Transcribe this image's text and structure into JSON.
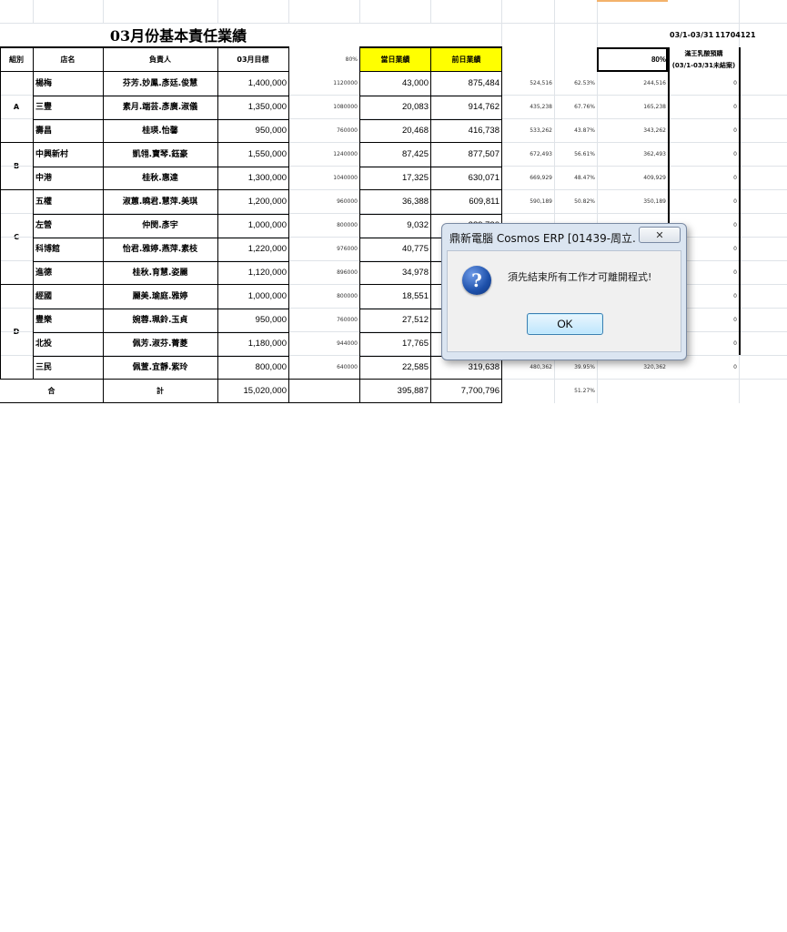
{
  "sheet": {
    "title": "03月份基本責任業績",
    "date_range": "03/1-03/31",
    "code": "11704121",
    "headers": {
      "group": "組別",
      "store": "店名",
      "manager": "負責人",
      "target": "03月目標",
      "pct80": "80%",
      "today": "當日業績",
      "prior": "前日業績",
      "pct80b": "80%",
      "bonus_line1": "滿王乳酸預購",
      "bonus_line2": "(03/1-03/31未結案)"
    },
    "groups": [
      {
        "name": "A"
      },
      {
        "name": "B"
      },
      {
        "name": "C"
      },
      {
        "name": "D"
      }
    ],
    "rows": [
      {
        "store": "楊梅",
        "manager": "芬芳.妙鳳.彥廷.俊慧",
        "target": "1,400,000",
        "t80": "1120000",
        "today": "43,000",
        "prior": "875,484",
        "v1": "524,516",
        "pct": "62.53%",
        "diff": "244,516",
        "bonus": "0"
      },
      {
        "store": "三豐",
        "manager": "素月.端芸.彥廣.淑儀",
        "target": "1,350,000",
        "t80": "1080000",
        "today": "20,083",
        "prior": "914,762",
        "v1": "435,238",
        "pct": "67.76%",
        "diff": "165,238",
        "bonus": "0"
      },
      {
        "store": "壽昌",
        "manager": "桂瑛.怡馨",
        "target": "950,000",
        "t80": "760000",
        "today": "20,468",
        "prior": "416,738",
        "v1": "533,262",
        "pct": "43.87%",
        "diff": "343,262",
        "bonus": "0"
      },
      {
        "store": "中興新村",
        "manager": "凱翎.寶琴.鈺豪",
        "target": "1,550,000",
        "t80": "1240000",
        "today": "87,425",
        "prior": "877,507",
        "v1": "672,493",
        "pct": "56.61%",
        "diff": "362,493",
        "bonus": "0"
      },
      {
        "store": "中港",
        "manager": "桂秋.惠達",
        "target": "1,300,000",
        "t80": "1040000",
        "today": "17,325",
        "prior": "630,071",
        "v1": "669,929",
        "pct": "48.47%",
        "diff": "409,929",
        "bonus": "0"
      },
      {
        "store": "五權",
        "manager": "淑蕙.曉君.慧萍.美琪",
        "target": "1,200,000",
        "t80": "960000",
        "today": "36,388",
        "prior": "609,811",
        "v1": "590,189",
        "pct": "50.82%",
        "diff": "350,189",
        "bonus": "0"
      },
      {
        "store": "左營",
        "manager": "仲閔.彥宇",
        "target": "1,000,000",
        "t80": "800000",
        "today": "9,032",
        "prior": "289,730",
        "v1": "",
        "pct": "",
        "diff": "",
        "bonus": "0"
      },
      {
        "store": "科博館",
        "manager": "怡君.雅婷.燕萍.素枝",
        "target": "1,220,000",
        "t80": "976000",
        "today": "40,775",
        "prior": "",
        "v1": "",
        "pct": "",
        "diff": "",
        "bonus": "0"
      },
      {
        "store": "進德",
        "manager": "桂秋.育慧.姿麗",
        "target": "1,120,000",
        "t80": "896000",
        "today": "34,978",
        "prior": "",
        "v1": "",
        "pct": "",
        "diff": "",
        "bonus": "0"
      },
      {
        "store": "經國",
        "manager": "麗美.瑜庭.雅婷",
        "target": "1,000,000",
        "t80": "800000",
        "today": "18,551",
        "prior": "",
        "v1": "",
        "pct": "",
        "diff": "",
        "bonus": "0"
      },
      {
        "store": "豐樂",
        "manager": "婉蓉.珮鈴.玉貞",
        "target": "950,000",
        "t80": "760000",
        "today": "27,512",
        "prior": "",
        "v1": "",
        "pct": "",
        "diff": "",
        "bonus": "0"
      },
      {
        "store": "北投",
        "manager": "佩芳.淑芬.菁菱",
        "target": "1,180,000",
        "t80": "944000",
        "today": "17,765",
        "prior": "",
        "v1": "",
        "pct": "",
        "diff": "",
        "bonus": "0"
      },
      {
        "store": "三民",
        "manager": "佩萱.宜靜.紫玲",
        "target": "800,000",
        "t80": "640000",
        "today": "22,585",
        "prior": "319,638",
        "v1": "480,362",
        "pct": "39.95%",
        "diff": "320,362",
        "bonus": "0"
      }
    ],
    "total": {
      "label1": "合",
      "label2": "計",
      "target": "15,020,000",
      "today": "395,887",
      "prior": "7,700,796",
      "pct": "51.27%"
    }
  },
  "dialog": {
    "title": "鼎新電腦 Cosmos ERP [01439-周立...",
    "message": "須先結束所有工作才可離開程式!",
    "ok_label": "OK",
    "close_glyph": "✕",
    "icon_glyph": "?",
    "icon": "question-icon"
  }
}
